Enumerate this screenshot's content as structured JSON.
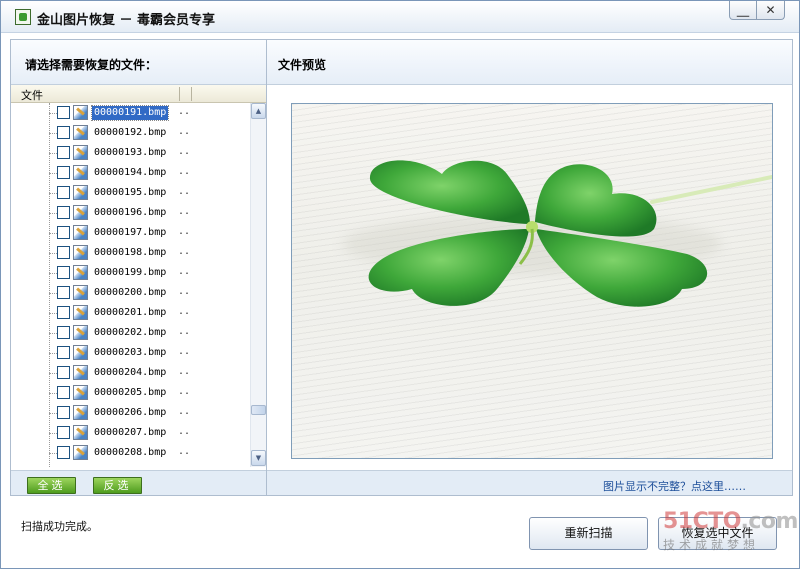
{
  "window": {
    "title": "金山图片恢复 － 毒霸会员专享",
    "minimize_label": "＿",
    "close_label": "✕"
  },
  "left_panel": {
    "heading": "请选择需要恢复的文件：",
    "column_header": "文件",
    "files": [
      {
        "name": "00000191.bmp",
        "extra": "..",
        "selected": true
      },
      {
        "name": "00000192.bmp",
        "extra": ".."
      },
      {
        "name": "00000193.bmp",
        "extra": ".."
      },
      {
        "name": "00000194.bmp",
        "extra": ".."
      },
      {
        "name": "00000195.bmp",
        "extra": ".."
      },
      {
        "name": "00000196.bmp",
        "extra": ".."
      },
      {
        "name": "00000197.bmp",
        "extra": ".."
      },
      {
        "name": "00000198.bmp",
        "extra": ".."
      },
      {
        "name": "00000199.bmp",
        "extra": ".."
      },
      {
        "name": "00000200.bmp",
        "extra": ".."
      },
      {
        "name": "00000201.bmp",
        "extra": ".."
      },
      {
        "name": "00000202.bmp",
        "extra": ".."
      },
      {
        "name": "00000203.bmp",
        "extra": ".."
      },
      {
        "name": "00000204.bmp",
        "extra": ".."
      },
      {
        "name": "00000205.bmp",
        "extra": ".."
      },
      {
        "name": "00000206.bmp",
        "extra": ".."
      },
      {
        "name": "00000207.bmp",
        "extra": ".."
      },
      {
        "name": "00000208.bmp",
        "extra": ".."
      }
    ],
    "select_all_label": "全选",
    "invert_label": "反选"
  },
  "right_panel": {
    "heading": "文件预览",
    "hint_link": "图片显示不完整？点这里……"
  },
  "footer": {
    "status": "扫描成功完成。",
    "rescan_label": "重新扫描",
    "restore_label": "恢复选中文件"
  },
  "watermark": {
    "main": "51CTO",
    "suffix": ".com",
    "sub": "技术成就梦想"
  },
  "colors": {
    "accent_blue": "#316ac5",
    "green_button": "#4e9c1e",
    "link": "#1e4f9a"
  }
}
